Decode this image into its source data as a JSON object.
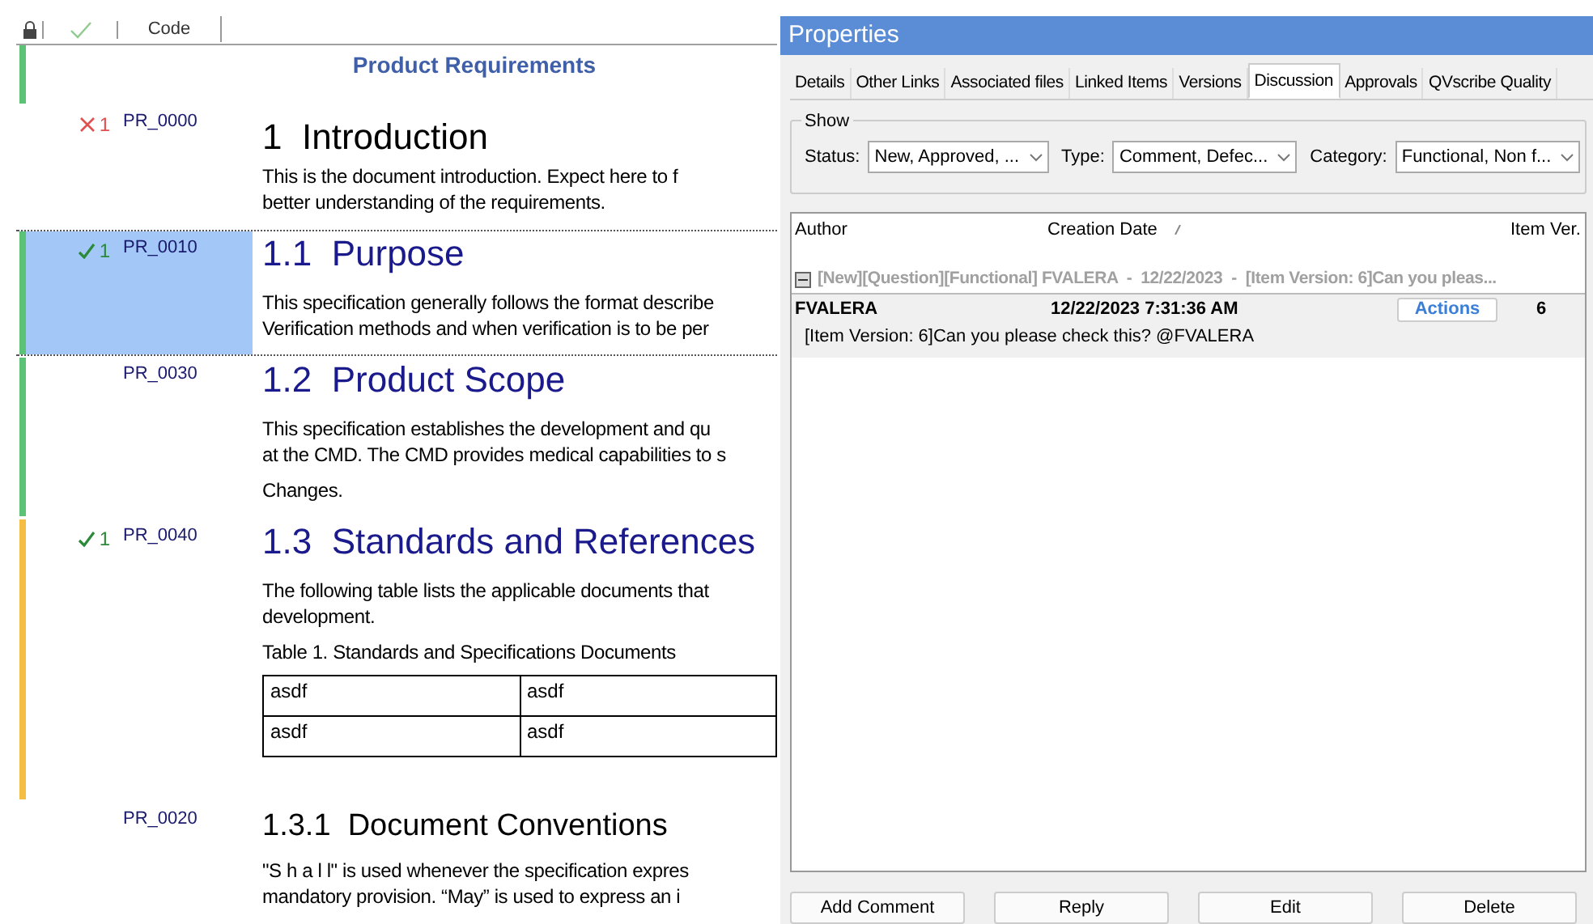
{
  "document": {
    "columns": [
      {
        "kind": "lock"
      },
      {
        "kind": "check"
      },
      {
        "kind": "text",
        "label": "Code"
      }
    ],
    "title": "Product Requirements",
    "rows": [
      {
        "code": "PR_0000",
        "mark": {
          "kind": "cross",
          "count": "1"
        },
        "selected": false,
        "blocks": [
          {
            "kind": "h1",
            "number": "1",
            "text": "Introduction"
          },
          {
            "kind": "para",
            "lines": [
              "This is the document introduction. Expect here to f",
              "better understanding of the requirements."
            ]
          }
        ]
      },
      {
        "code": "PR_0010",
        "mark": {
          "kind": "check",
          "count": "1"
        },
        "color": "#5cc276",
        "selected": true,
        "blocks": [
          {
            "kind": "h2",
            "number": "1.1",
            "text": "Purpose"
          },
          {
            "kind": "para",
            "lines": [
              "This specification generally follows the format describe",
              "Verification methods and when verification is to be per"
            ]
          }
        ]
      },
      {
        "code": "PR_0030",
        "color": "#5cc276",
        "selected": false,
        "blocks": [
          {
            "kind": "h2",
            "number": "1.2",
            "text": "Product Scope"
          },
          {
            "kind": "para",
            "lines": [
              "This specification establishes the development and qu",
              "at the CMD.  The CMD provides medical capabilities to s"
            ]
          },
          {
            "kind": "para",
            "lines": [
              "Changes."
            ]
          }
        ]
      },
      {
        "code": "PR_0040",
        "mark": {
          "kind": "check",
          "count": "1"
        },
        "color": "#f5bd42",
        "selected": false,
        "blocks": [
          {
            "kind": "h2",
            "number": "1.3",
            "text": "Standards and References"
          },
          {
            "kind": "para",
            "lines": [
              "The following table lists the applicable documents that",
              "development."
            ]
          },
          {
            "kind": "para",
            "lines": [
              "Table 1. Standards and Specifications Documents"
            ]
          },
          {
            "kind": "table",
            "rows": [
              [
                "asdf",
                "asdf"
              ],
              [
                "asdf",
                "asdf"
              ]
            ]
          }
        ]
      },
      {
        "code": "PR_0020",
        "selected": false,
        "blocks": [
          {
            "kind": "h3",
            "number": "1.3.1",
            "text": "Document Conventions"
          },
          {
            "kind": "para",
            "lines": [
              "\"S h a l l\" is used whenever the specification expres",
              "mandatory provision. “May” is used to express an i"
            ]
          }
        ]
      }
    ]
  },
  "properties": {
    "title": "Properties",
    "tabs": [
      {
        "label": "Details",
        "selected": false
      },
      {
        "label": "Other Links",
        "selected": false
      },
      {
        "label": "Associated files",
        "selected": false
      },
      {
        "label": "Linked Items",
        "selected": false
      },
      {
        "label": "Versions",
        "selected": false
      },
      {
        "label": "Discussion",
        "selected": true
      },
      {
        "label": "Approvals",
        "selected": false
      },
      {
        "label": "QVscribe Quality",
        "selected": false
      }
    ],
    "show": {
      "label": "Show",
      "filters": [
        {
          "label": "Status:",
          "value": "New, Approved, ..."
        },
        {
          "label": "Type:",
          "value": "Comment, Defec..."
        },
        {
          "label": "Category:",
          "value": "Functional, Non f..."
        }
      ]
    },
    "grid": {
      "columns": [
        "Author",
        "Creation Date",
        "Item Ver."
      ],
      "groups": [
        {
          "header": "[New][Question][Functional] FVALERA  -  12/22/2023  -  [Item Version: 6]Can you pleas...",
          "expanded": true,
          "comments": [
            {
              "author": "FVALERA",
              "date": "12/22/2023 7:31:36 AM",
              "action": "Actions",
              "version": "6",
              "text": "[Item Version: 6]Can you please check this? @FVALERA"
            }
          ]
        }
      ]
    },
    "buttons": [
      "Add Comment",
      "Reply",
      "Edit",
      "Delete"
    ]
  }
}
